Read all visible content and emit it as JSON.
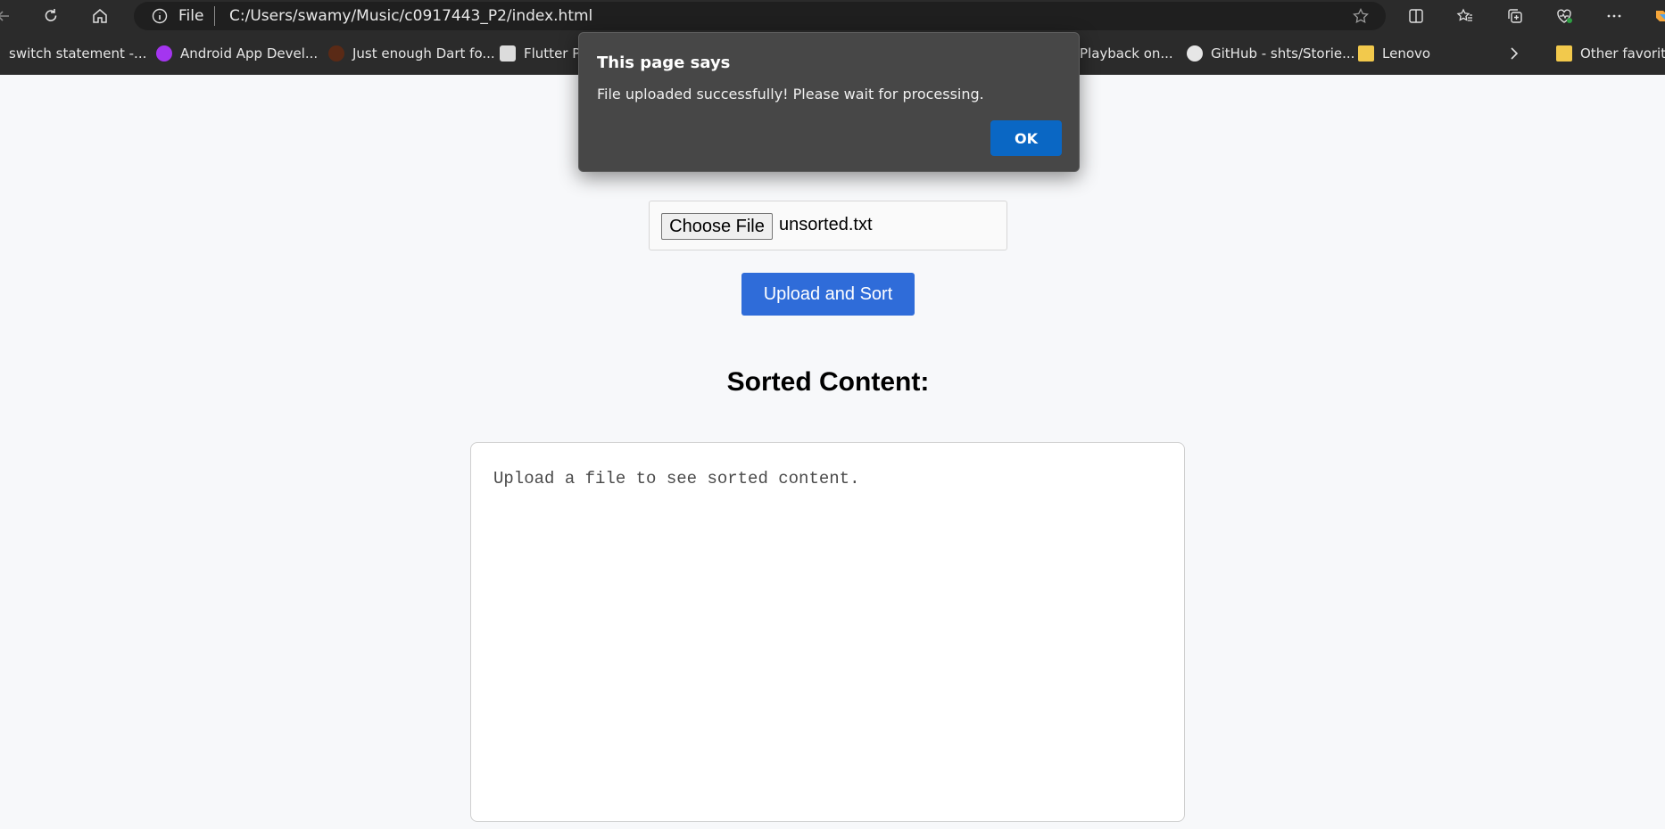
{
  "browser": {
    "address": {
      "scheme": "File",
      "url": "C:/Users/swamy/Music/c0917443_P2/index.html"
    },
    "bookmarks": [
      {
        "label": "switch statement -...",
        "icon": "page-icon"
      },
      {
        "label": "Android App Devel...",
        "icon": "udemy-icon",
        "color": "#a435f0"
      },
      {
        "label": "Just enough Dart fo...",
        "icon": "site-icon",
        "color": "#c24a1e"
      },
      {
        "label": "Flutter Pl",
        "icon": "flutter-icon"
      },
      {
        "label": "Playback on...",
        "icon": "page-icon"
      },
      {
        "label": "GitHub - shts/Storie...",
        "icon": "github-icon"
      },
      {
        "label": "Lenovo",
        "icon": "folder-icon",
        "color": "#f2c94c"
      },
      {
        "label": "Other favorites",
        "icon": "folder-icon",
        "color": "#f2c94c"
      }
    ]
  },
  "page": {
    "file_input": {
      "button_label": "Choose File",
      "file_name": "unsorted.txt"
    },
    "upload_button": "Upload and Sort",
    "sorted_heading": "Sorted Content:",
    "output_placeholder": "Upload a file to see sorted content."
  },
  "dialog": {
    "title": "This page says",
    "message": "File uploaded successfully! Please wait for processing.",
    "ok_label": "OK"
  },
  "colors": {
    "accent": "#2f6cd9",
    "dialog_button": "#0a67c4"
  }
}
